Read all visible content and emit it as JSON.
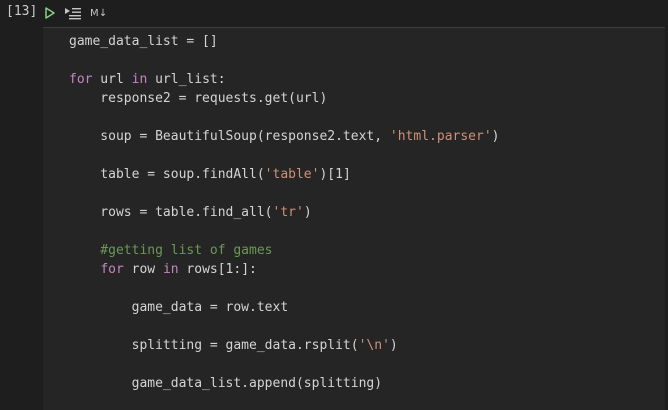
{
  "cell": {
    "execution_count": "[13]",
    "toolbar": {
      "run_icon": "play-icon",
      "run_by_line_icon": "run-by-line-icon",
      "cell_type_label": "M↓"
    },
    "colors": {
      "keyword": "#c586c0",
      "string": "#ce9178",
      "comment": "#6a9955",
      "text": "#d4d4d4",
      "run_icon": "#89d185"
    },
    "code_lines": [
      [
        {
          "t": "game_data_list = []"
        }
      ],
      [],
      [
        {
          "t": "for",
          "c": "kw"
        },
        {
          "t": " url "
        },
        {
          "t": "in",
          "c": "kw"
        },
        {
          "t": " url_list:"
        }
      ],
      [
        {
          "t": "    response2 = requests.get(url)"
        }
      ],
      [],
      [
        {
          "t": "    soup = BeautifulSoup(response2.text, "
        },
        {
          "t": "'html.parser'",
          "c": "str"
        },
        {
          "t": ")"
        }
      ],
      [],
      [
        {
          "t": "    table = soup.findAll("
        },
        {
          "t": "'table'",
          "c": "str"
        },
        {
          "t": ")[1]"
        }
      ],
      [],
      [
        {
          "t": "    rows = table.find_all("
        },
        {
          "t": "'tr'",
          "c": "str"
        },
        {
          "t": ")"
        }
      ],
      [],
      [
        {
          "t": "    #getting list of games",
          "c": "cmt"
        }
      ],
      [
        {
          "t": "    "
        },
        {
          "t": "for",
          "c": "kw"
        },
        {
          "t": " row "
        },
        {
          "t": "in",
          "c": "kw"
        },
        {
          "t": " rows[1:]:"
        }
      ],
      [],
      [
        {
          "t": "        game_data = row.text"
        }
      ],
      [],
      [
        {
          "t": "        splitting = game_data.rsplit("
        },
        {
          "t": "'\\n'",
          "c": "str"
        },
        {
          "t": ")"
        }
      ],
      [],
      [
        {
          "t": "        game_data_list.append(splitting)"
        }
      ]
    ]
  }
}
